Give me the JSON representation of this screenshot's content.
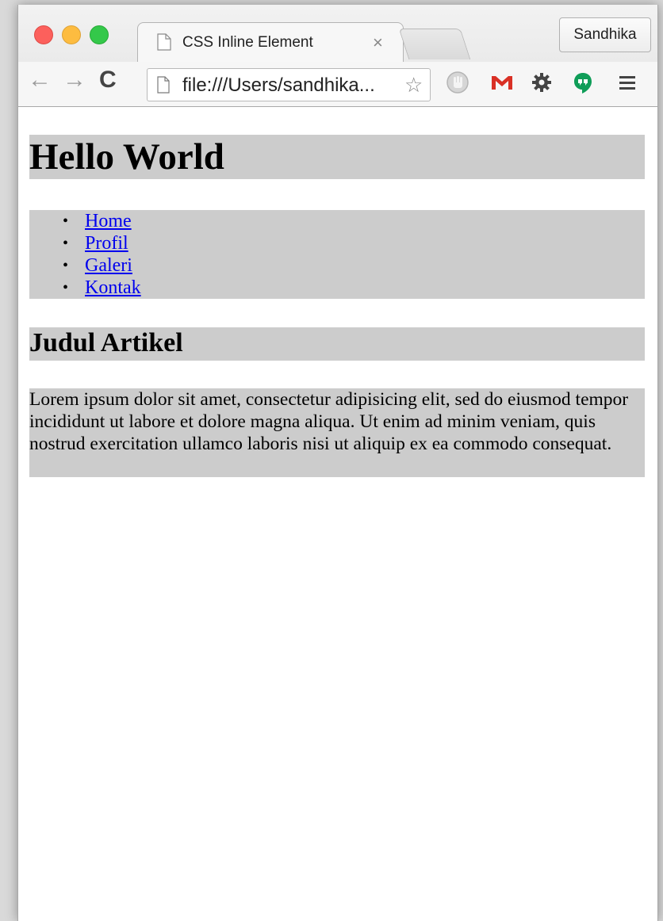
{
  "browser": {
    "tab": {
      "title": "CSS Inline Element",
      "close_glyph": "×"
    },
    "profile_button": "Sandhika",
    "address_bar": {
      "url": "file:///Users/sandhika..."
    },
    "nav_glyphs": {
      "back": "←",
      "forward": "→",
      "reload": "C"
    },
    "extensions": [
      "hand-icon",
      "gmail-icon",
      "gear-icon",
      "hangouts-icon",
      "menu-icon"
    ]
  },
  "page": {
    "heading": "Hello World",
    "nav_items": [
      {
        "label": "Home"
      },
      {
        "label": "Profil"
      },
      {
        "label": "Galeri"
      },
      {
        "label": "Kontak"
      }
    ],
    "article_title": "Judul Artikel",
    "article_body": "Lorem ipsum dolor sit amet, consectetur adipisicing elit, sed do eiusmod tempor incididunt ut labore et dolore magna aliqua. Ut enim ad minim veniam, quis nostrud exercitation ullamco laboris nisi ut aliquip ex ea commodo consequat."
  },
  "colors": {
    "block_background": "#cccccc",
    "link": "#0000ee",
    "traffic_close": "#fc605c",
    "traffic_minimize": "#fdbc40",
    "traffic_maximize": "#34c84a",
    "gmail_red": "#d93025",
    "hangouts_green": "#0f9d58"
  }
}
